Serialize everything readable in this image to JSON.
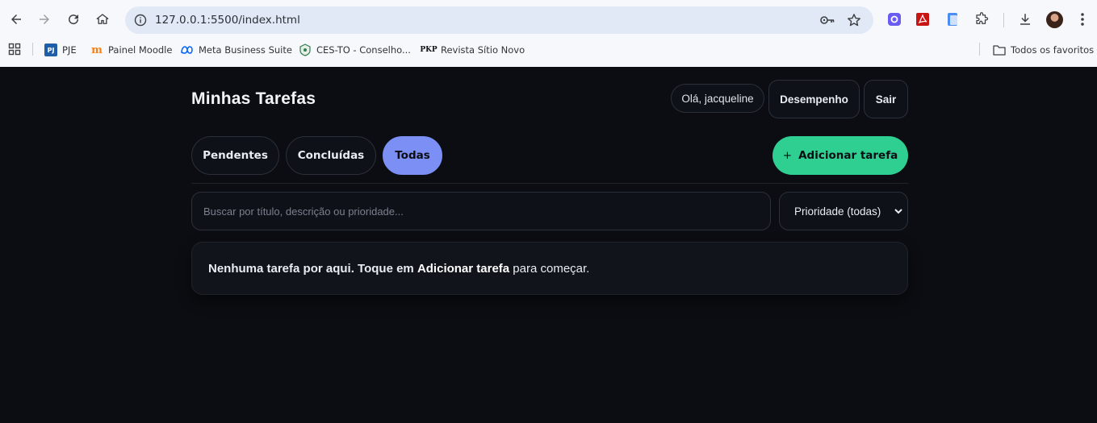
{
  "browser": {
    "url": "127.0.0.1:5500/index.html",
    "bookmarks": [
      {
        "label": "PJE",
        "icon": "pje-icon"
      },
      {
        "label": "Painel Moodle",
        "icon": "moodle-icon"
      },
      {
        "label": "Meta Business Suite",
        "icon": "meta-icon"
      },
      {
        "label": "CES-TO - Conselho...",
        "icon": "ces-icon"
      },
      {
        "label": "Revista Sítio Novo",
        "icon": "pkp-icon"
      }
    ],
    "all_bookmarks_label": "Todos os favoritos",
    "pkp_badge": "PKP"
  },
  "app": {
    "title": "Minhas Tarefas",
    "greeting": "Olá, jacqueline",
    "performance_label": "Desempenho",
    "logout_label": "Sair"
  },
  "tabs": [
    {
      "label": "Pendentes",
      "active": false
    },
    {
      "label": "Concluídas",
      "active": false
    },
    {
      "label": "Todas",
      "active": true
    }
  ],
  "add_task": {
    "icon": "+",
    "label": "Adicionar tarefa"
  },
  "search": {
    "placeholder": "Buscar por título, descrição ou prioridade...",
    "value": ""
  },
  "priority_filter": {
    "selected": "Prioridade (todas)"
  },
  "empty_state": {
    "prefix": "Nenhuma tarefa por aqui. Toque em ",
    "highlight": "Adicionar tarefa",
    "suffix": " para começar."
  },
  "colors": {
    "background": "#0b0d12",
    "accent_tab": "#7b8ff5",
    "add_button": "#2fcf92"
  }
}
